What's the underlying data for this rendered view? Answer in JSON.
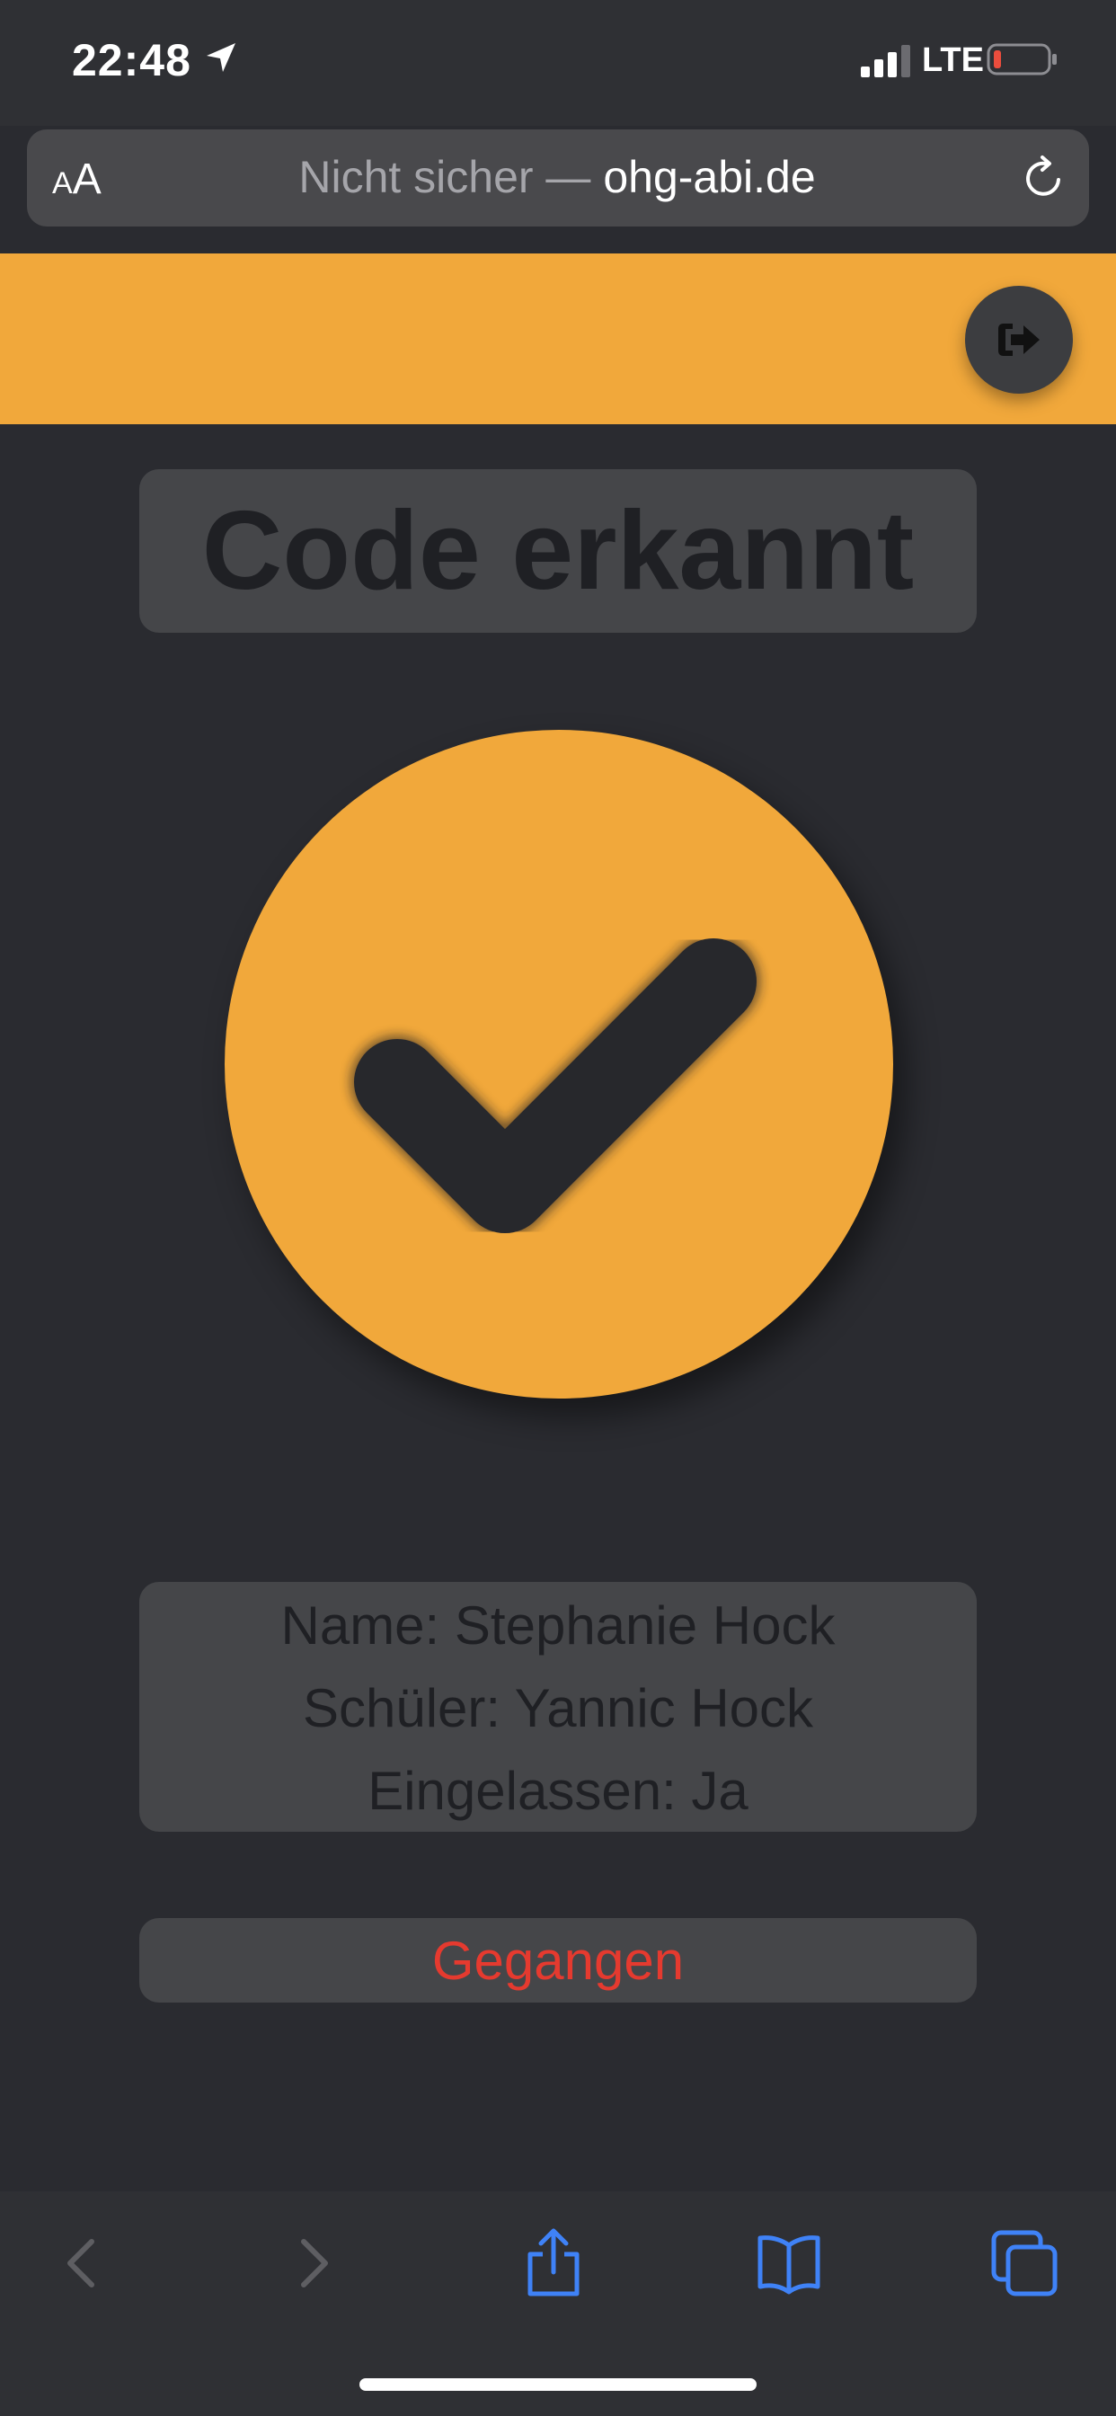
{
  "status_bar": {
    "time": "22:48",
    "network": "LTE",
    "icons": [
      "location-arrow-icon",
      "signal-icon",
      "battery-icon"
    ]
  },
  "browser": {
    "text_size_label_small": "A",
    "text_size_label_large": "A",
    "url_prefix": "Nicht sicher — ",
    "url_host": "ohg-abi.de",
    "reload_icon": "reload-icon"
  },
  "header": {
    "logout_icon": "logout-icon",
    "accent_color": "#f1a83b"
  },
  "main": {
    "title": "Code erkannt",
    "status_icon": "checkmark-icon",
    "info": {
      "name": "Name: Stephanie Hock",
      "student": "Schüler: Yannic Hock",
      "admitted": "Eingelassen: Ja"
    },
    "gone_button": "Gegangen",
    "gone_color": "#e53a2f"
  },
  "toolbar": {
    "items": [
      "back-icon",
      "forward-icon",
      "share-icon",
      "bookmarks-icon",
      "tabs-icon"
    ],
    "active_color": "#3f82f7"
  }
}
